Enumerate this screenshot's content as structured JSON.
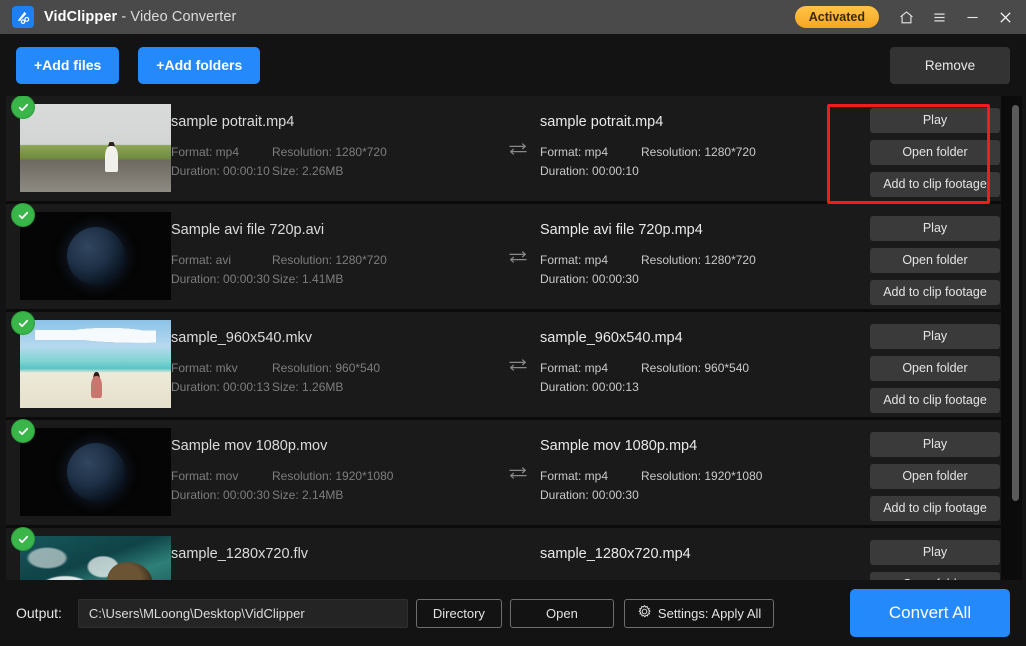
{
  "titlebar": {
    "app_name": "VidClipper",
    "subtitle": " - Video Converter",
    "activated_label": "Activated",
    "icons": [
      "home-icon",
      "menu-icon",
      "minimize-icon",
      "close-icon"
    ],
    "background": "#4a4a4a",
    "activated_color": "#f5a623"
  },
  "toolbar": {
    "add_files_label": "+Add files",
    "add_folders_label": "+Add folders",
    "remove_label": "Remove",
    "accent_color": "#2489fb"
  },
  "actions": {
    "play": "Play",
    "open_folder": "Open folder",
    "add_to_clip_footage": "Add to clip footage"
  },
  "highlight": {
    "color": "#f41b1b",
    "target": "row-1-action-buttons"
  },
  "list": {
    "rows": [
      {
        "checked": true,
        "thumb": "field-person-thumbnail",
        "source": {
          "filename": "sample potrait.mp4",
          "format": "Format: mp4",
          "resolution": "Resolution: 1280*720",
          "duration": "Duration: 00:00:10",
          "size": "Size: 2.26MB"
        },
        "target": {
          "filename": "sample potrait.mp4",
          "format": "Format: mp4",
          "resolution": "Resolution: 1280*720",
          "duration": "Duration: 00:00:10",
          "size": ""
        }
      },
      {
        "checked": true,
        "thumb": "earth-space-thumbnail",
        "source": {
          "filename": "Sample avi file 720p.avi",
          "format": "Format: avi",
          "resolution": "Resolution: 1280*720",
          "duration": "Duration: 00:00:30",
          "size": "Size: 1.41MB"
        },
        "target": {
          "filename": "Sample avi file 720p.mp4",
          "format": "Format: mp4",
          "resolution": "Resolution: 1280*720",
          "duration": "Duration: 00:00:30",
          "size": ""
        }
      },
      {
        "checked": true,
        "thumb": "beach-person-thumbnail",
        "source": {
          "filename": "sample_960x540.mkv",
          "format": "Format: mkv",
          "resolution": "Resolution: 960*540",
          "duration": "Duration: 00:00:13",
          "size": "Size: 1.26MB"
        },
        "target": {
          "filename": "sample_960x540.mp4",
          "format": "Format: mp4",
          "resolution": "Resolution: 960*540",
          "duration": "Duration: 00:00:13",
          "size": ""
        }
      },
      {
        "checked": true,
        "thumb": "earth-space-thumbnail",
        "source": {
          "filename": "Sample mov 1080p.mov",
          "format": "Format: mov",
          "resolution": "Resolution: 1920*1080",
          "duration": "Duration: 00:00:30",
          "size": "Size: 2.14MB"
        },
        "target": {
          "filename": "Sample mov 1080p.mp4",
          "format": "Format: mp4",
          "resolution": "Resolution: 1920*1080",
          "duration": "Duration: 00:00:30",
          "size": ""
        }
      },
      {
        "checked": true,
        "thumb": "ocean-waves-thumbnail",
        "source": {
          "filename": "sample_1280x720.flv",
          "format": "",
          "resolution": "",
          "duration": "",
          "size": ""
        },
        "target": {
          "filename": "sample_1280x720.mp4",
          "format": "",
          "resolution": "",
          "duration": "",
          "size": ""
        }
      }
    ]
  },
  "output": {
    "label": "Output:",
    "path_value": "C:\\Users\\MLoong\\Desktop\\VidClipper",
    "path_placeholder": "Output folder",
    "directory_label": "Directory",
    "open_label": "Open",
    "settings_label": "Settings: Apply All",
    "convert_label": "Convert All"
  }
}
